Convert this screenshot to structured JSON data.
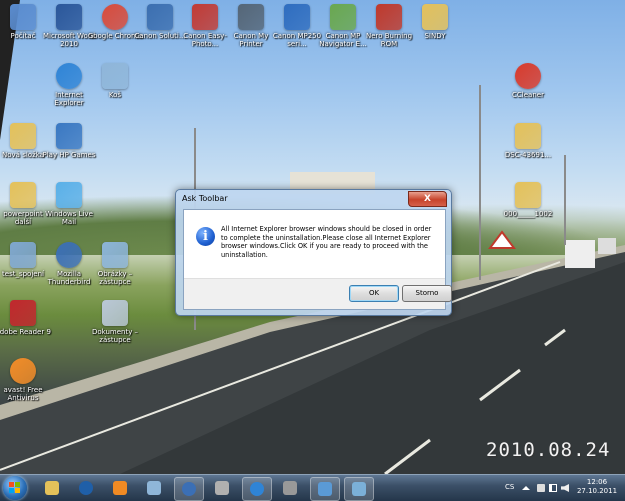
{
  "desktop": {
    "icons": [
      {
        "label": "Počítač",
        "icon": "computer-icon",
        "color": "#5a8ccf"
      },
      {
        "label": "Microsoft Word 2010",
        "icon": "word-icon",
        "color": "#2b579a"
      },
      {
        "label": "Google Chrome",
        "icon": "chrome-icon",
        "color": "#d94b3b"
      },
      {
        "label": "Canon Soluti...",
        "icon": "canon-solution-icon",
        "color": "#3c6fb0"
      },
      {
        "label": "Canon Easy-Photo...",
        "icon": "canon-easy-photo-icon",
        "color": "#c23b34"
      },
      {
        "label": "Canon My Printer",
        "icon": "canon-printer-icon",
        "color": "#556677"
      },
      {
        "label": "Canon MP250 seri...",
        "icon": "canon-mp250-icon",
        "color": "#2f6dbf"
      },
      {
        "label": "Canon MP Navigator E...",
        "icon": "canon-navigator-icon",
        "color": "#6aa84f"
      },
      {
        "label": "Nero Burning ROM",
        "icon": "nero-icon",
        "color": "#c0392b"
      },
      {
        "label": "SINDY",
        "icon": "folder-icon",
        "color": "#e4c15a"
      },
      {
        "label": "Internet Explorer",
        "icon": "ie-icon",
        "color": "#2f84d6"
      },
      {
        "label": "Koš",
        "icon": "recycle-bin-icon",
        "color": "#8fb6d9"
      },
      {
        "label": "CCleaner",
        "icon": "ccleaner-icon",
        "color": "#d93a2b"
      },
      {
        "label": "Nová složka",
        "icon": "folder-icon",
        "color": "#e4c15a"
      },
      {
        "label": "Play HP Games",
        "icon": "hp-games-icon",
        "color": "#3a78c2"
      },
      {
        "label": "DSC-43691...",
        "icon": "folder-icon",
        "color": "#e4c15a"
      },
      {
        "label": "powerpoint další",
        "icon": "folder-icon",
        "color": "#e4c15a"
      },
      {
        "label": "Windows Live Mail",
        "icon": "live-mail-icon",
        "color": "#5ab0e8"
      },
      {
        "label": "000_____1002",
        "icon": "folder-icon",
        "color": "#e4c15a"
      },
      {
        "label": "test_spojení",
        "icon": "network-test-icon",
        "color": "#7fa7cf"
      },
      {
        "label": "Mozilla Thunderbird",
        "icon": "thunderbird-icon",
        "color": "#3b6fb5"
      },
      {
        "label": "Obrázky – zástupce",
        "icon": "pictures-shortcut-icon",
        "color": "#8cb4d8"
      },
      {
        "label": "Adobe Reader 9",
        "icon": "adobe-reader-icon",
        "color": "#c1272d"
      },
      {
        "label": "Dokumenty – zástupce",
        "icon": "documents-shortcut-icon",
        "color": "#b9c7d6"
      },
      {
        "label": "avast! Free Antivirus",
        "icon": "avast-icon",
        "color": "#f28c28"
      }
    ],
    "date_stamp": "2010.08.24"
  },
  "dialog": {
    "title": "Ask Toolbar",
    "close": "X",
    "info_icon": "i",
    "message": "All Internet Explorer browser windows should be closed in order to complete the uninstallation.Please close all Internet Explorer browser windows.Click OK if you are ready to proceed with the uninstallation.",
    "ok_label": "OK",
    "cancel_label": "Storno"
  },
  "taskbar": {
    "items": [
      {
        "icon": "explorer-folder-icon",
        "color": "#e4c15a"
      },
      {
        "icon": "hp-icon",
        "color": "#1f5fa8"
      },
      {
        "icon": "media-player-icon",
        "color": "#f08a24"
      },
      {
        "icon": "paint-icon",
        "color": "#8fb6d9"
      },
      {
        "icon": "thunderbird-icon",
        "color": "#3b6fb5"
      },
      {
        "icon": "documents-icon",
        "color": "#b0b0b0"
      },
      {
        "icon": "ie-icon",
        "color": "#2f84d6"
      },
      {
        "icon": "utility-icon",
        "color": "#999999"
      },
      {
        "icon": "control-panel-icon",
        "color": "#5a9ad6"
      },
      {
        "icon": "installer-icon",
        "color": "#7bb0d8"
      },
      {
        "icon": "setup-icon",
        "color": "#6d8fb8"
      }
    ],
    "lang": "CS",
    "time": "12:06",
    "date": "27.10.2011"
  }
}
